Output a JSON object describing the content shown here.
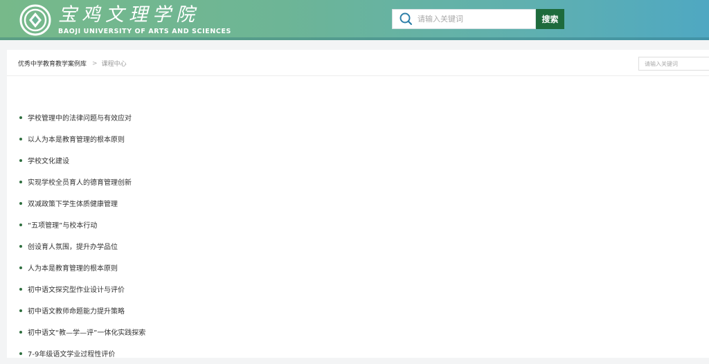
{
  "header": {
    "logo_cn": "宝鸡文理学院",
    "logo_en": "BAOJI UNIVERSITY OF ARTS AND SCIENCES",
    "search_placeholder": "请输入关键词",
    "search_button": "搜索",
    "colors": {
      "accent": "#1e6b3c",
      "bullet": "#2f6f3f"
    },
    "icons": {
      "emblem": "university-emblem-icon",
      "search": "search-icon"
    }
  },
  "breadcrumb": {
    "root": "优秀中学教育教学案例库",
    "separator": ">",
    "current": "课程中心"
  },
  "side_search": {
    "placeholder": "请输入关键词"
  },
  "courses": [
    "学校管理中的法律问题与有效应对",
    "以人为本是教育管理的根本原则",
    "学校文化建设",
    "实现学校全员育人的德育管理创新",
    "双减政策下学生体质健康管理",
    "“五项管理”与校本行动",
    "创设育人氛围，提升办学品位",
    "人为本是教育管理的根本原则",
    "初中语文探究型作业设计与评价",
    "初中语文教师命题能力提升策略",
    "初中语文“教—学—评”一体化实践探索",
    "7-9年级语文学业过程性评价"
  ]
}
